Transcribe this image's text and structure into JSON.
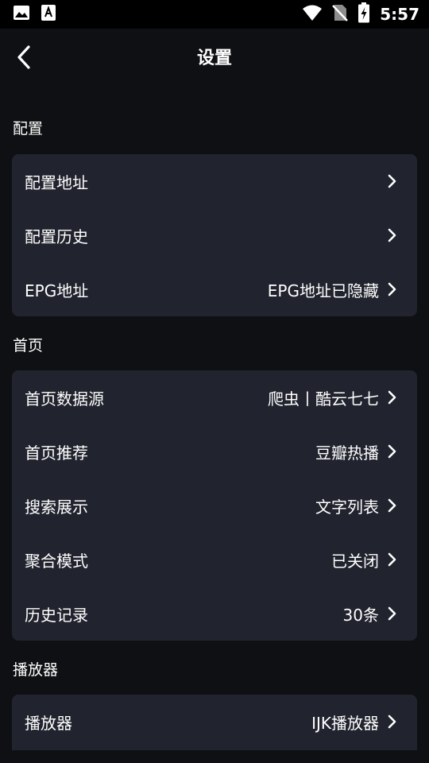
{
  "status_bar": {
    "time": "5:57",
    "icons": [
      "image-icon",
      "font-a-icon",
      "wifi-icon",
      "no-sim-icon",
      "battery-charging-icon"
    ]
  },
  "app_bar": {
    "title": "设置",
    "back_icon": "chevron-left-icon"
  },
  "sections": {
    "config": {
      "label": "配置",
      "rows": [
        {
          "label": "配置地址",
          "value": ""
        },
        {
          "label": "配置历史",
          "value": ""
        },
        {
          "label": "EPG地址",
          "value": "EPG地址已隐藏"
        }
      ]
    },
    "home": {
      "label": "首页",
      "rows": [
        {
          "label": "首页数据源",
          "value": "爬虫丨酷云七七"
        },
        {
          "label": "首页推荐",
          "value": "豆瓣热播"
        },
        {
          "label": "搜索展示",
          "value": "文字列表"
        },
        {
          "label": "聚合模式",
          "value": "已关闭"
        },
        {
          "label": "历史记录",
          "value": "30条"
        }
      ]
    },
    "player": {
      "label": "播放器",
      "rows": [
        {
          "label": "播放器",
          "value": "IJK播放器"
        }
      ]
    }
  },
  "colors": {
    "background": "#0f1013",
    "card": "#21232e",
    "text": "#ffffff"
  }
}
